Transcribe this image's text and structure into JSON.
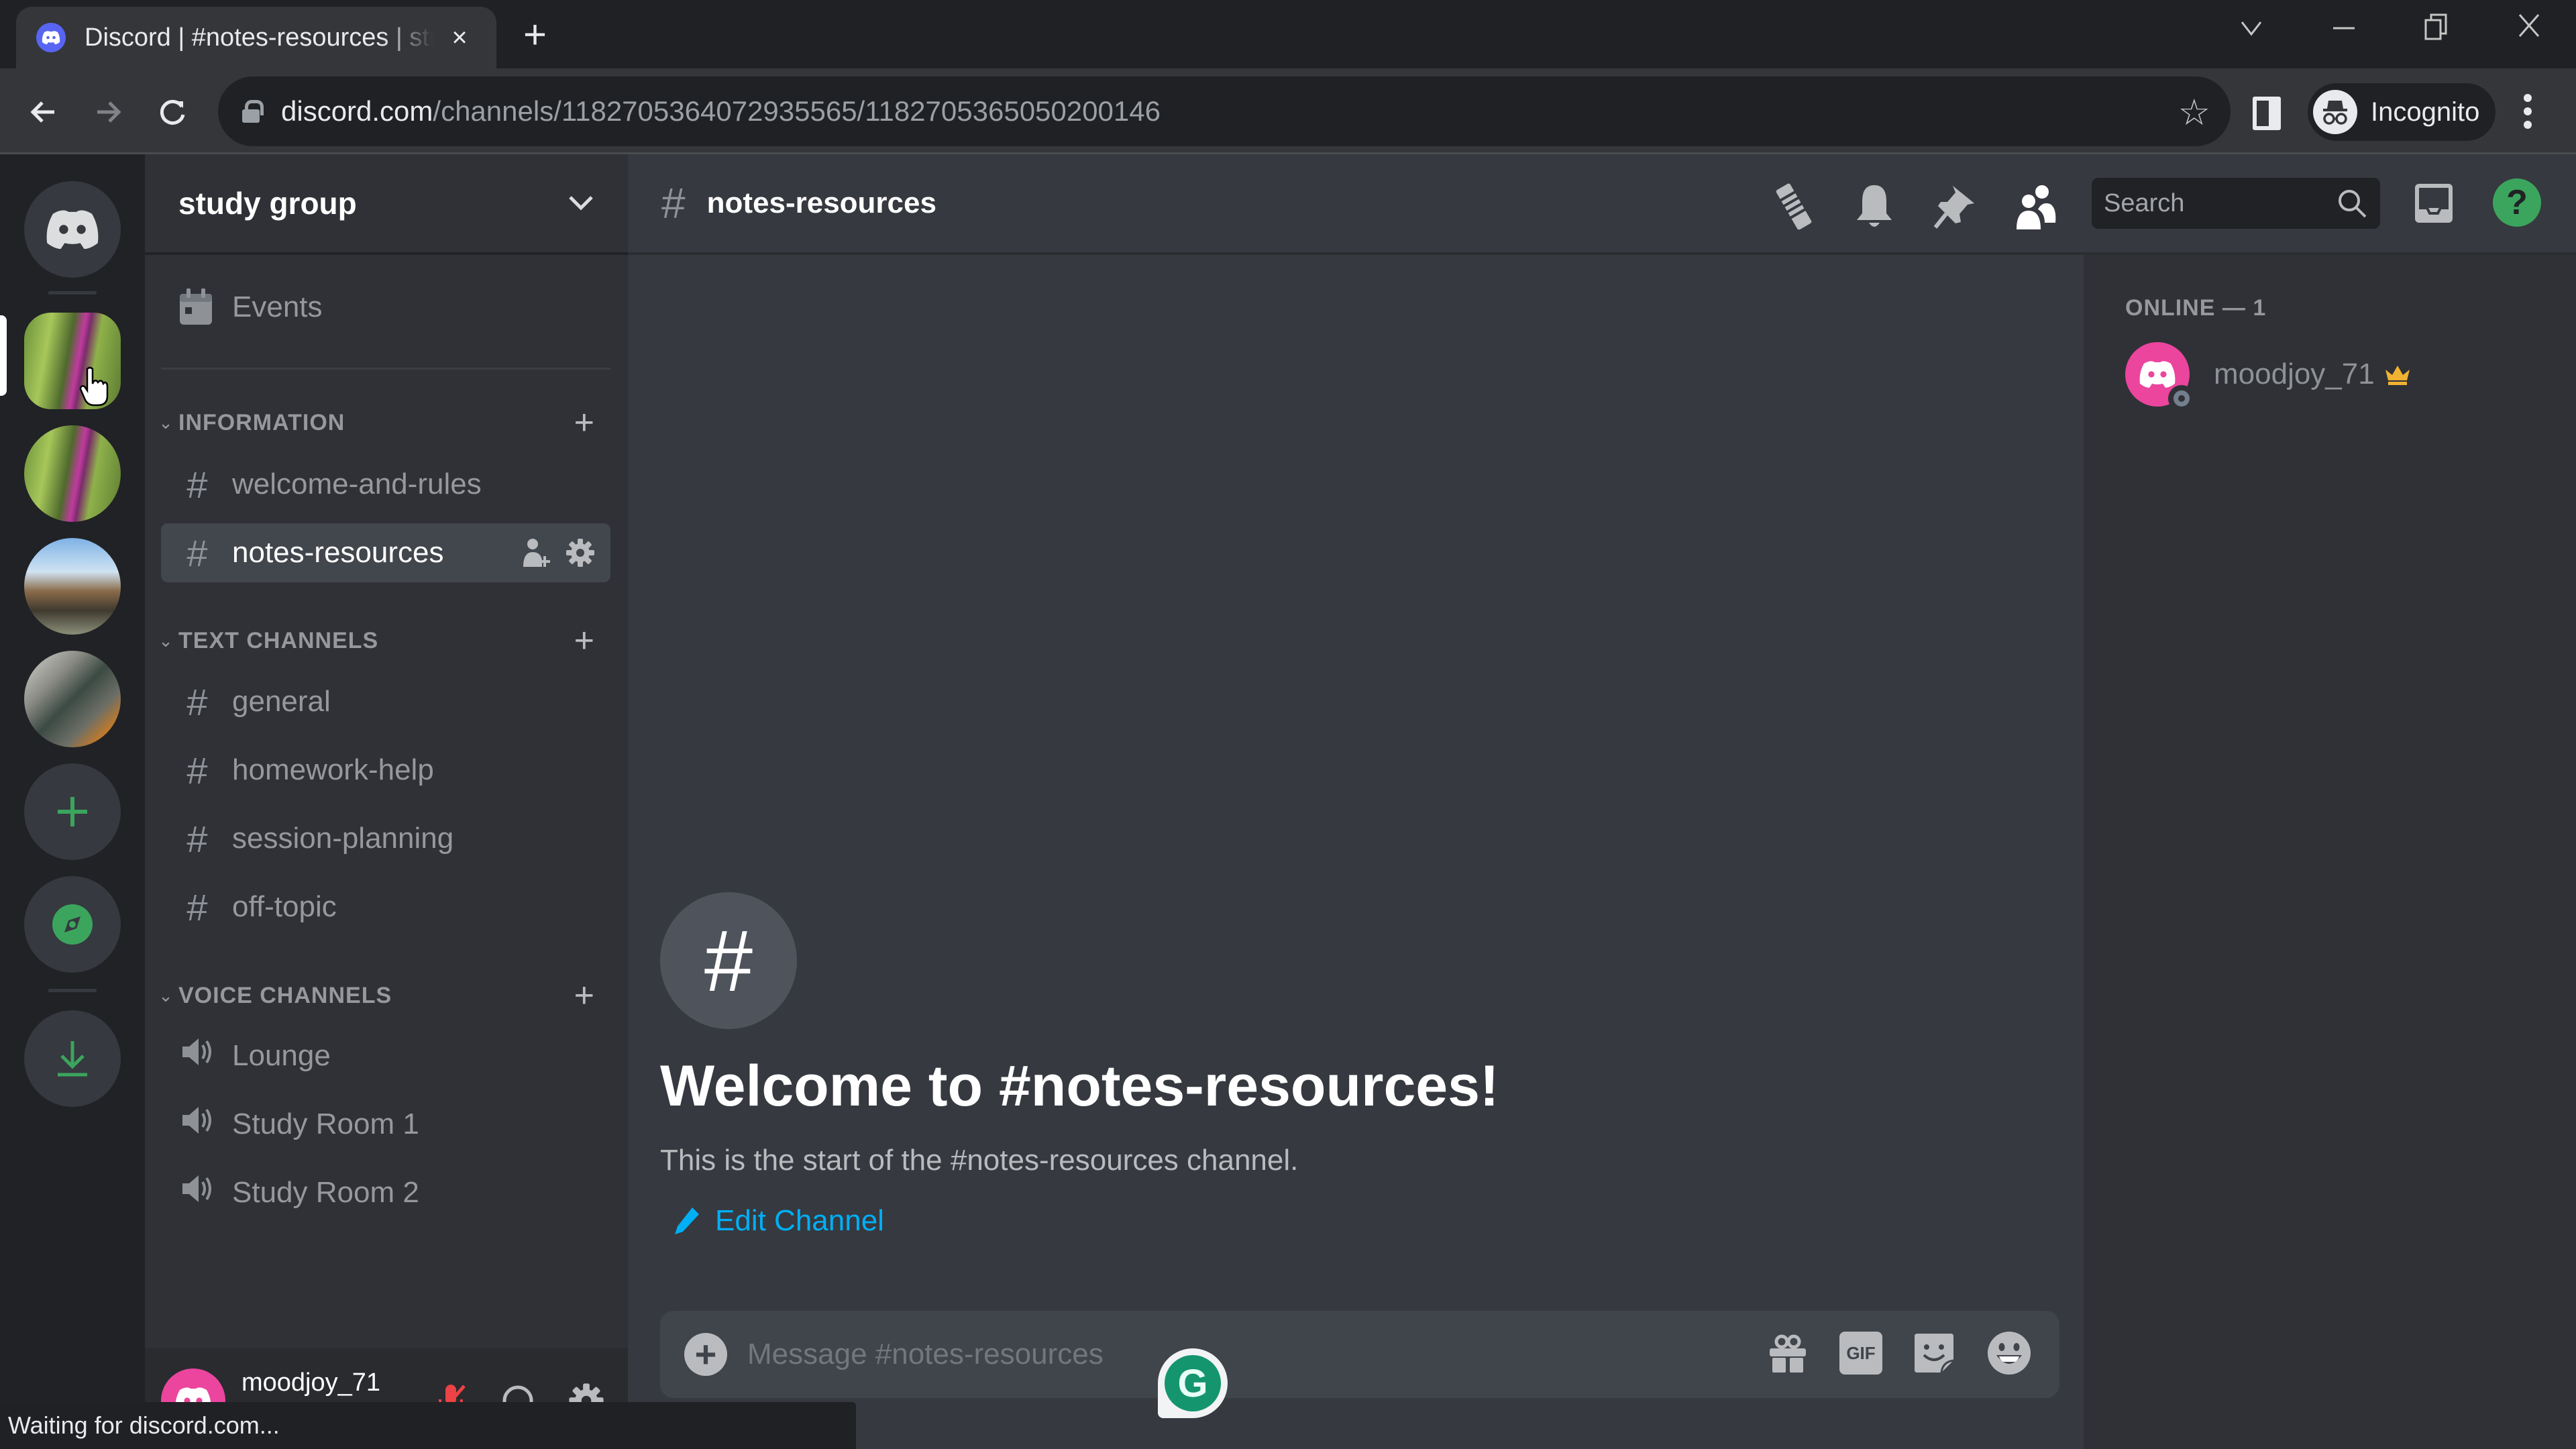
{
  "browser": {
    "tab_title": "Discord | #notes-resources | study group",
    "tab_close": "×",
    "new_tab": "+",
    "url_host": "discord.com",
    "url_path": "/channels/1182705364072935565/1182705365050200146",
    "profile_label": "Incognito",
    "status_text": "Waiting for discord.com..."
  },
  "server": {
    "name": "study group",
    "events_label": "Events",
    "categories": [
      {
        "label": "INFORMATION",
        "channels": [
          {
            "name": "welcome-and-rules",
            "type": "text",
            "active": false
          },
          {
            "name": "notes-resources",
            "type": "text",
            "active": true
          }
        ]
      },
      {
        "label": "TEXT CHANNELS",
        "channels": [
          {
            "name": "general",
            "type": "text"
          },
          {
            "name": "homework-help",
            "type": "text"
          },
          {
            "name": "session-planning",
            "type": "text"
          },
          {
            "name": "off-topic",
            "type": "text"
          }
        ]
      },
      {
        "label": "VOICE CHANNELS",
        "channels": [
          {
            "name": "Lounge",
            "type": "voice"
          },
          {
            "name": "Study Room 1",
            "type": "voice"
          },
          {
            "name": "Study Room 2",
            "type": "voice"
          }
        ]
      }
    ]
  },
  "user": {
    "name": "moodjoy_71"
  },
  "channel": {
    "name": "notes-resources",
    "search_placeholder": "Search",
    "help_glyph": "?",
    "welcome_title": "Welcome to #notes-resources!",
    "welcome_subtitle": "This is the start of the #notes-resources channel.",
    "edit_label": "Edit Channel",
    "composer_placeholder": "Message #notes-resources",
    "gif_label": "GIF"
  },
  "members": {
    "heading": "ONLINE — 1",
    "list": [
      {
        "name": "moodjoy_71",
        "owner": true,
        "status": "offline-ring"
      }
    ]
  },
  "colors": {
    "brand": "#5865f2",
    "link": "#00aff4",
    "online_green": "#3ba55d",
    "avatar_pink": "#eb459e",
    "crown": "#f0b232",
    "mute_red": "#ed4245"
  }
}
